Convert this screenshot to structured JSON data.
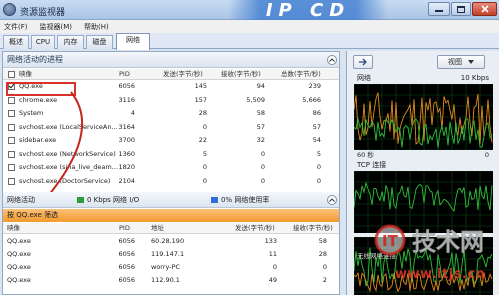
{
  "window": {
    "title": "资源监视器"
  },
  "watermark": {
    "top": "IP CD",
    "logo_text": "技术网",
    "url": "www.itjs.cn"
  },
  "menu": [
    "文件(F)",
    "监视器(M)",
    "帮助(H)"
  ],
  "tabs": [
    "概述",
    "CPU",
    "内存",
    "磁盘",
    "网络"
  ],
  "active_tab": "网络",
  "processes": {
    "title": "网络活动的进程",
    "columns": [
      "映像",
      "PID",
      "发送(字节/秒)",
      "接收(字节/秒)",
      "总数(字节/秒)"
    ],
    "rows": [
      {
        "name": "QQ.exe",
        "pid": "6056",
        "send": "145",
        "recv": "94",
        "total": "239",
        "checked": true
      },
      {
        "name": "chrome.exe",
        "pid": "3116",
        "send": "157",
        "recv": "5,509",
        "total": "5,666",
        "checked": false
      },
      {
        "name": "System",
        "pid": "4",
        "send": "28",
        "recv": "58",
        "total": "86",
        "checked": false
      },
      {
        "name": "svchost.exe (LocalServiceAn...",
        "pid": "3164",
        "send": "0",
        "recv": "57",
        "total": "57",
        "checked": false
      },
      {
        "name": "sidebar.exe",
        "pid": "3700",
        "send": "22",
        "recv": "32",
        "total": "54",
        "checked": false
      },
      {
        "name": "svchost.exe (NetworkService)",
        "pid": "1360",
        "send": "5",
        "recv": "0",
        "total": "5",
        "checked": false
      },
      {
        "name": "svchost.exe (sina_live_deam...",
        "pid": "1820",
        "send": "0",
        "recv": "0",
        "total": "0",
        "checked": false
      },
      {
        "name": "svchost.exe (DoctorService)",
        "pid": "2104",
        "send": "0",
        "recv": "0",
        "total": "0",
        "checked": false
      }
    ]
  },
  "activity": {
    "title": "网络活动",
    "io": "0 Kbps 网络 I/O",
    "usage": "0% 网络使用率",
    "io_color": "#2e9c3a",
    "usage_color": "#2f6fd6"
  },
  "filter": {
    "label": "按 QQ.exe 筛选"
  },
  "connections": {
    "columns": [
      "映像",
      "PID",
      "地址",
      "发送(字节/秒)",
      "接收(字节/秒)"
    ],
    "rows": [
      {
        "name": "QQ.exe",
        "pid": "6056",
        "addr": "60.28.190",
        "send": "133",
        "recv": "58"
      },
      {
        "name": "QQ.exe",
        "pid": "6056",
        "addr": "119.147.1",
        "send": "11",
        "recv": "28"
      },
      {
        "name": "QQ.exe",
        "pid": "6056",
        "addr": "worry-PC",
        "send": "0",
        "recv": "0"
      },
      {
        "name": "QQ.exe",
        "pid": "6056",
        "addr": "112.90.1",
        "send": "49",
        "recv": "2"
      }
    ]
  },
  "right": {
    "view_label": "视图",
    "network_label": "网络",
    "network_scale": "10 Kbps",
    "time_label": "60 秒",
    "time_scale": "0",
    "tcp_label": "TCP 连接",
    "wireless_label": "无线网络连接"
  }
}
